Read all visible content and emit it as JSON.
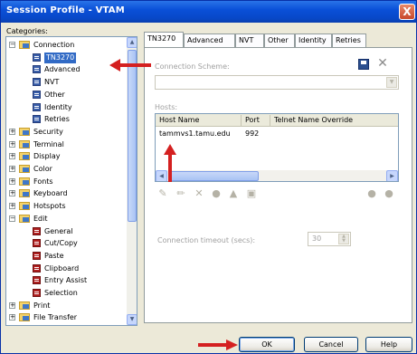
{
  "window": {
    "title": "Session Profile - VTAM",
    "close": "X"
  },
  "categories_label": "Categories:",
  "tree": [
    {
      "label": "Connection",
      "level": 0,
      "type": "folder",
      "expanded": true
    },
    {
      "label": "TN3270",
      "level": 1,
      "type": "page",
      "selected": true
    },
    {
      "label": "Advanced",
      "level": 1,
      "type": "page"
    },
    {
      "label": "NVT",
      "level": 1,
      "type": "page"
    },
    {
      "label": "Other",
      "level": 1,
      "type": "page"
    },
    {
      "label": "Identity",
      "level": 1,
      "type": "page"
    },
    {
      "label": "Retries",
      "level": 1,
      "type": "page"
    },
    {
      "label": "Security",
      "level": 0,
      "type": "folder"
    },
    {
      "label": "Terminal",
      "level": 0,
      "type": "folder"
    },
    {
      "label": "Display",
      "level": 0,
      "type": "folder"
    },
    {
      "label": "Color",
      "level": 0,
      "type": "folder"
    },
    {
      "label": "Fonts",
      "level": 0,
      "type": "folder"
    },
    {
      "label": "Keyboard",
      "level": 0,
      "type": "folder"
    },
    {
      "label": "Hotspots",
      "level": 0,
      "type": "folder"
    },
    {
      "label": "Edit",
      "level": 0,
      "type": "folder",
      "expanded": true
    },
    {
      "label": "General",
      "level": 1,
      "type": "page-red"
    },
    {
      "label": "Cut/Copy",
      "level": 1,
      "type": "page-red"
    },
    {
      "label": "Paste",
      "level": 1,
      "type": "page-red"
    },
    {
      "label": "Clipboard",
      "level": 1,
      "type": "page-red"
    },
    {
      "label": "Entry Assist",
      "level": 1,
      "type": "page-red"
    },
    {
      "label": "Selection",
      "level": 1,
      "type": "page-red"
    },
    {
      "label": "Print",
      "level": 0,
      "type": "folder"
    },
    {
      "label": "File Transfer",
      "level": 0,
      "type": "folder"
    }
  ],
  "tabs": [
    "TN3270",
    "Advanced",
    "NVT",
    "Other",
    "Identity",
    "Retries"
  ],
  "panel": {
    "connection_scheme_label": "Connection Scheme:",
    "hosts_label": "Hosts:",
    "columns": [
      "Host Name",
      "Port",
      "Telnet Name Override"
    ],
    "rows": [
      {
        "host": "tammvs1.tamu.edu",
        "port": "992",
        "override": ""
      }
    ],
    "timeout_label": "Connection timeout (secs):",
    "timeout_value": "30"
  },
  "buttons": {
    "ok": "OK",
    "cancel": "Cancel",
    "help": "Help"
  },
  "colors": {
    "annotation_arrow": "#d42020",
    "selection": "#316ac5",
    "titlebar": "#0a50d8"
  }
}
